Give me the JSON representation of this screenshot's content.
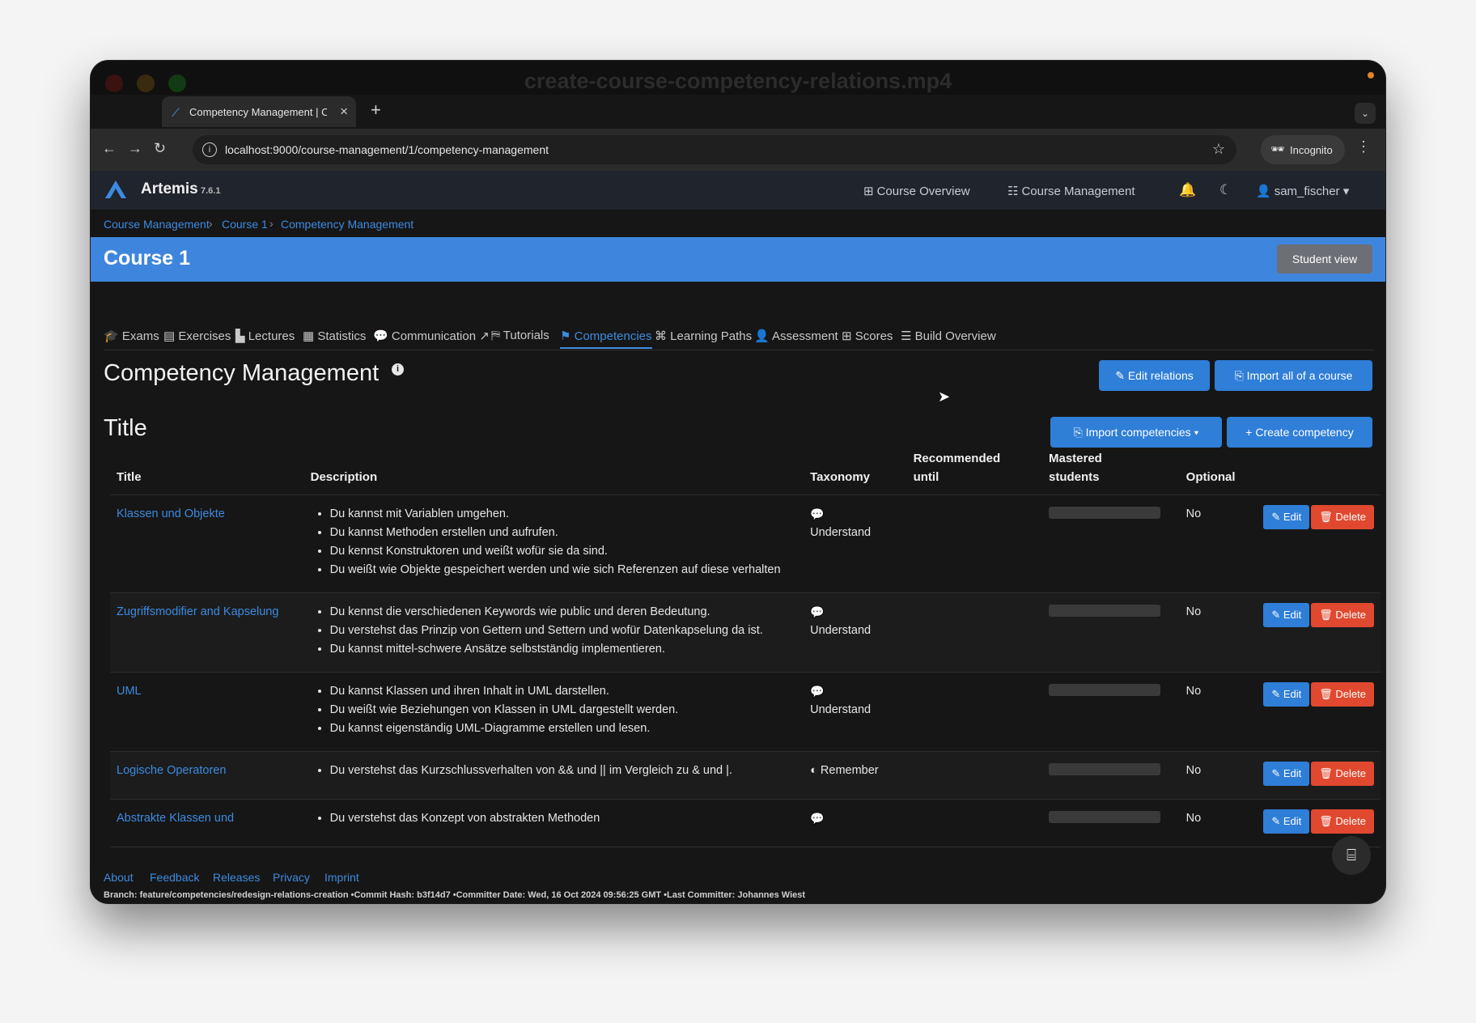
{
  "window": {
    "title": "create-course-competency-relations.mp4"
  },
  "browser": {
    "tab_title": "Competency Management | C",
    "url": "localhost:9000/course-management/1/competency-management",
    "incognito_label": "Incognito"
  },
  "app": {
    "brand": "Artemis",
    "version": "7.6.1",
    "nav": {
      "course_overview": "Course Overview",
      "course_management": "Course Management",
      "user": "sam_fischer"
    }
  },
  "breadcrumb": [
    "Course Management",
    "Course 1",
    "Competency Management"
  ],
  "course": {
    "title": "Course 1",
    "student_view": "Student view"
  },
  "course_tabs": [
    "Exams",
    "Exercises",
    "Lectures",
    "Statistics",
    "Communication",
    "Tutorials",
    "Competencies",
    "Learning Paths",
    "Assessment",
    "Scores",
    "Build Overview"
  ],
  "page": {
    "title": "Competency Management",
    "edit_relations": "Edit relations",
    "import_all": "Import all of a course",
    "section_title": "Title",
    "import_competencies": "Import competencies",
    "create_competency": "Create competency"
  },
  "table": {
    "headers": {
      "title": "Title",
      "description": "Description",
      "taxonomy": "Taxonomy",
      "recommended_until": "Recommended until",
      "mastered_students": "Mastered students",
      "optional": "Optional"
    },
    "edit_label": "Edit",
    "delete_label": "Delete",
    "rows": [
      {
        "title": "Klassen und Objekte",
        "description": [
          "Du kannst mit Variablen umgehen.",
          "Du kannst Methoden erstellen und aufrufen.",
          "Du kennst Konstruktoren und weißt wofür sie da sind.",
          "Du weißt wie Objekte gespeichert werden und wie sich Referenzen auf diese verhalten"
        ],
        "taxonomy": "Understand",
        "taxonomy_icon": "comments-icon",
        "optional": "No"
      },
      {
        "title": "Zugriffsmodifier and Kapselung",
        "description": [
          "Du kennst die verschiedenen Keywords wie public und deren Bedeutung.",
          "Du verstehst das Prinzip von Gettern und Settern und wofür Datenkapselung da ist.",
          "Du kannst mittel-schwere Ansätze selbstständig implementieren."
        ],
        "taxonomy": "Understand",
        "taxonomy_icon": "comments-icon",
        "optional": "No"
      },
      {
        "title": "UML",
        "description": [
          "Du kannst Klassen und ihren Inhalt in UML darstellen.",
          "Du weißt wie Beziehungen von Klassen in UML dargestellt werden.",
          "Du kannst eigenständig UML-Diagramme erstellen und lesen."
        ],
        "taxonomy": "Understand",
        "taxonomy_icon": "comments-icon",
        "optional": "No"
      },
      {
        "title": "Logische Operatoren",
        "description": [
          "Du verstehst das Kurzschlussverhalten von && und || im Vergleich zu & und |."
        ],
        "taxonomy": "Remember",
        "taxonomy_icon": "brain-icon",
        "optional": "No"
      },
      {
        "title": "Abstrakte Klassen und",
        "description": [
          "Du verstehst das Konzept von abstrakten Methoden"
        ],
        "taxonomy": "",
        "taxonomy_icon": "comments-icon",
        "optional": "No"
      }
    ]
  },
  "footer": {
    "links": [
      "About",
      "Feedback",
      "Releases",
      "Privacy",
      "Imprint"
    ],
    "meta": "Branch: feature/competencies/redesign-relations-creation •Commit Hash: b3f14d7 •Committer Date: Wed, 16 Oct 2024 09:56:25 GMT •Last Committer: Johannes Wiest"
  }
}
